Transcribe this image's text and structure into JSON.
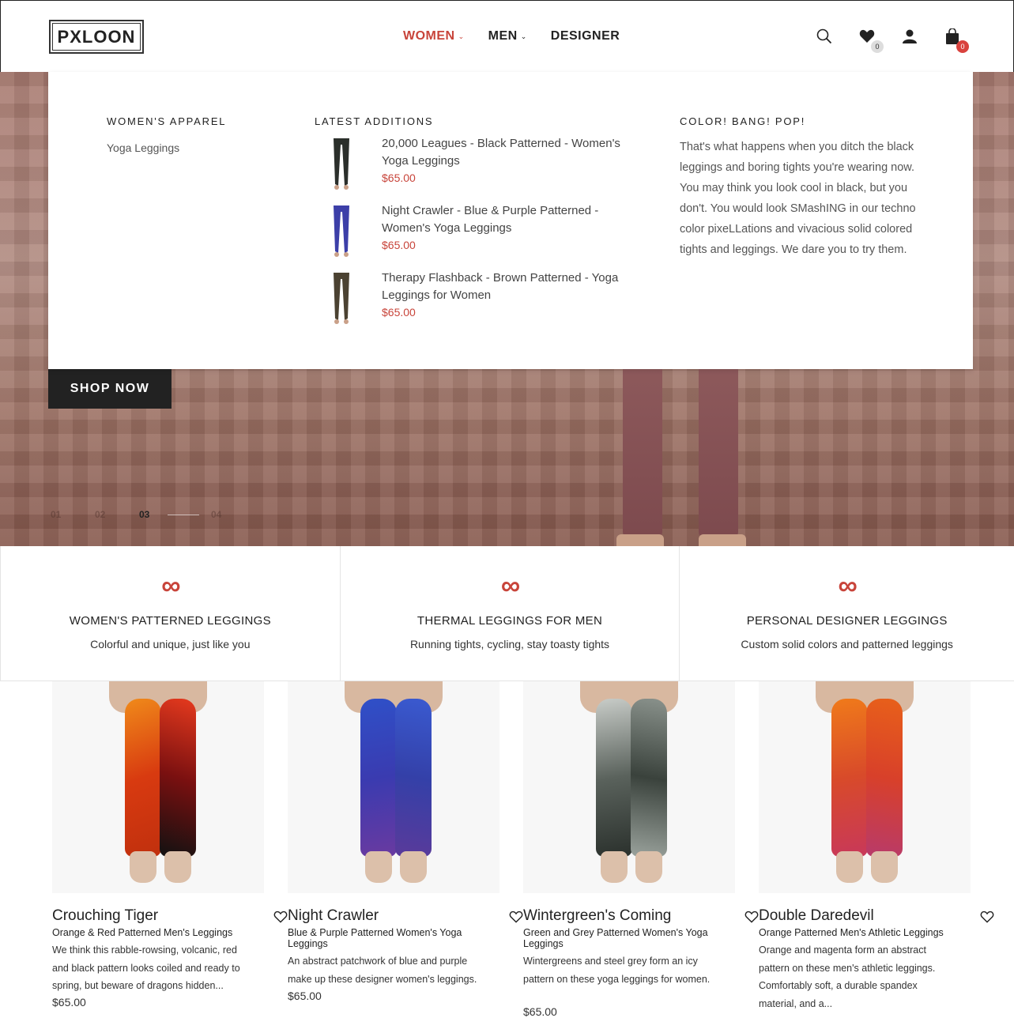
{
  "header": {
    "logo": "PXLOON",
    "nav": [
      {
        "label": "WOMEN",
        "chevron": true,
        "active": true
      },
      {
        "label": "MEN",
        "chevron": true,
        "active": false
      },
      {
        "label": "DESIGNER",
        "chevron": false,
        "active": false
      }
    ],
    "wishlist_count": "0",
    "cart_count": "0"
  },
  "mega_menu": {
    "apparel_title": "WOMEN'S APPAREL",
    "apparel_links": [
      "Yoga Leggings"
    ],
    "latest_title": "LATEST ADDITIONS",
    "latest": [
      {
        "name": "20,000 Leagues - Black Patterned - Women's Yoga Leggings",
        "price": "$65.00"
      },
      {
        "name": "Night Crawler - Blue & Purple Patterned - Women's Yoga Leggings",
        "price": "$65.00"
      },
      {
        "name": "Therapy Flashback - Brown Patterned - Yoga Leggings for Women",
        "price": "$65.00"
      }
    ],
    "promo_title": "COLOR! BANG! POP!",
    "promo_text": "That's what happens when you ditch the black leggings and boring tights you're wearing now. You may think you look cool in black, but you don't. You would look SMashING in our techno color pixeLLations and vivacious solid colored tights and leggings. We dare you to try them."
  },
  "hero": {
    "cta": "SHOP NOW",
    "slides": [
      "01",
      "02",
      "03",
      "04"
    ],
    "current_slide": "03"
  },
  "categories": [
    {
      "title": "WOMEN'S PATTERNED LEGGINGS",
      "subtitle": "Colorful and unique, just like you"
    },
    {
      "title": "THERMAL LEGGINGS FOR MEN",
      "subtitle": "Running tights, cycling, stay toasty tights"
    },
    {
      "title": "PERSONAL DESIGNER LEGGINGS",
      "subtitle": "Custom solid colors and patterned leggings"
    }
  ],
  "products": [
    {
      "title": "Crouching Tiger",
      "subtitle": "Orange & Red Patterned Men's Leggings",
      "description": "We think this rabble-rowsing, volcanic, red and black pattern looks coiled and ready to spring, but beware of dragons hidden...",
      "price": "$65.00"
    },
    {
      "title": "Night Crawler",
      "subtitle": "Blue & Purple Patterned Women's Yoga Leggings",
      "description": "An abstract patchwork of blue and purple make up these designer women's leggings.",
      "price": "$65.00"
    },
    {
      "title": "Wintergreen's Coming",
      "subtitle": "Green and Grey Patterned Women's Yoga Leggings",
      "description": "Wintergreens and steel grey form an icy pattern on these yoga leggings for women.",
      "price": "$65.00"
    },
    {
      "title": "Double Daredevil",
      "subtitle": "Orange Patterned Men's Athletic Leggings",
      "description": "Orange and magenta form an abstract pattern on these men's athletic leggings. Comfortably soft, a durable spandex material, and a...",
      "price": ""
    }
  ],
  "colors": {
    "accent": "#c8443a",
    "dark": "#222222",
    "badge_red": "#d9423e"
  },
  "icons": [
    "search-icon",
    "heart-icon",
    "user-icon",
    "bag-icon",
    "infinity-icon"
  ]
}
